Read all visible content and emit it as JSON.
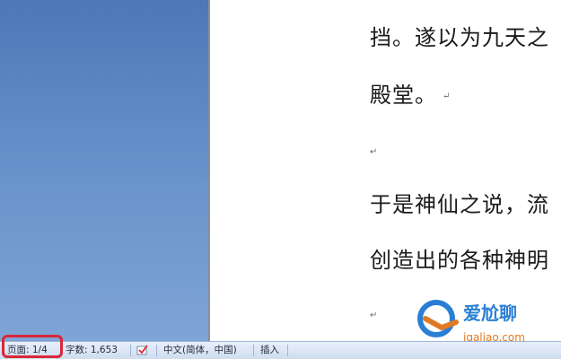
{
  "document": {
    "lines": [
      "挡。遂以为九天之",
      "殿堂。",
      "于是神仙之说，流",
      "创造出的各种神明"
    ],
    "paragraph_mark": "↵"
  },
  "statusbar": {
    "page_label": "页面: 1/4",
    "word_count": "字数: 1,653",
    "language": "中文(简体，中国)",
    "mode": "插入"
  },
  "watermark": {
    "text_top": "爱尬聊",
    "text_bottom": "igaliao.com"
  },
  "colors": {
    "workspace": "#5b86c2",
    "statusbar": "#dbe6f4",
    "highlight": "#d9283a",
    "watermark_blue": "#2a7fd4",
    "watermark_orange": "#e07a24"
  },
  "icons": [
    "proofing-icon",
    "watermark-logo-icon"
  ]
}
